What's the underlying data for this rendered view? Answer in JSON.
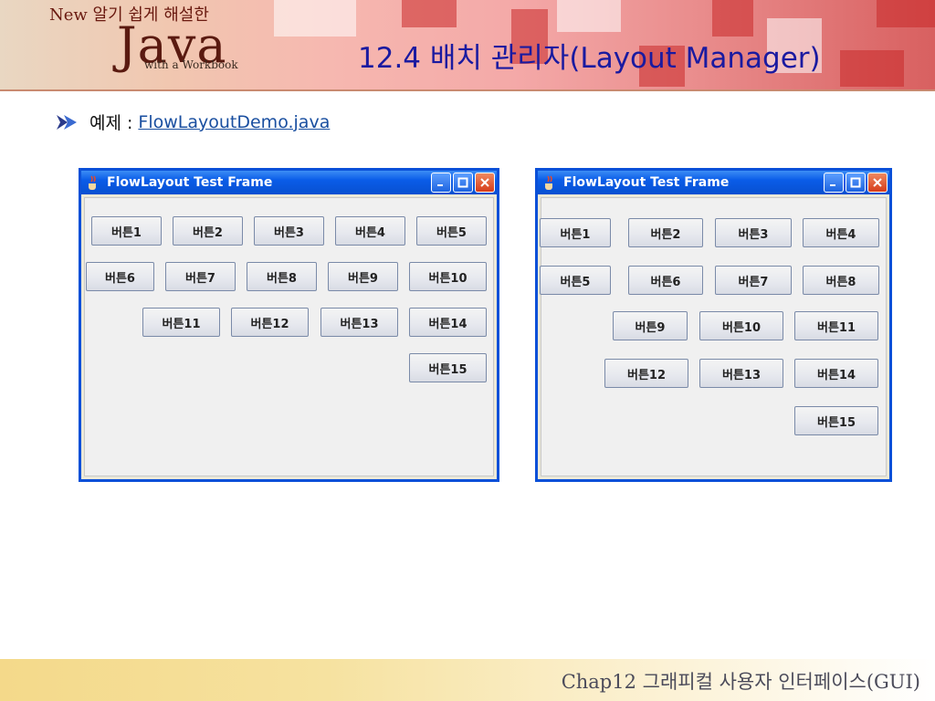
{
  "header": {
    "logo_new": "New 알기 쉽게 해설한",
    "logo_java": "Java",
    "logo_sub": "with a Workbook",
    "title": "12.4 배치 관리자(Layout Manager)"
  },
  "bullet": {
    "label": "예제 :",
    "link": "FlowLayoutDemo.java"
  },
  "windows": [
    {
      "title": "FlowLayout Test Frame",
      "buttons": [
        "버튼1",
        "버튼2",
        "버튼3",
        "버튼4",
        "버튼5",
        "버튼6",
        "버튼7",
        "버튼8",
        "버튼9",
        "버튼10",
        "버튼11",
        "버튼12",
        "버튼13",
        "버튼14",
        "버튼15"
      ]
    },
    {
      "title": "FlowLayout Test Frame",
      "buttons": [
        "버튼1",
        "버튼2",
        "버튼3",
        "버튼4",
        "버튼5",
        "버튼6",
        "버튼7",
        "버튼8",
        "버튼9",
        "버튼10",
        "버튼11",
        "버튼12",
        "버튼13",
        "버튼14",
        "버튼15"
      ]
    }
  ],
  "footer": {
    "text": "Chap12 그래피컬 사용자 인터페이스(GUI)"
  },
  "colors": {
    "title": "#1a1aa0",
    "window_border": "#0a50d8",
    "link": "#1a4fa0"
  }
}
